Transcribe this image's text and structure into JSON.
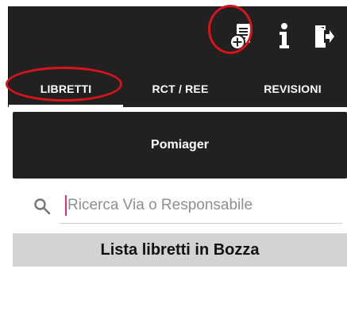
{
  "toolbar": {
    "actions": [
      {
        "icon": "new-document-icon"
      },
      {
        "icon": "info-icon"
      },
      {
        "icon": "logout-icon"
      }
    ]
  },
  "tabs": [
    {
      "label": "LIBRETTI",
      "active": true
    },
    {
      "label": "RCT / REE",
      "active": false
    },
    {
      "label": "REVISIONI",
      "active": false
    }
  ],
  "primary_button": {
    "label": "Pomiager"
  },
  "search": {
    "placeholder": "Ricerca Via o Responsabile"
  },
  "list": {
    "title": "Lista libretti in Bozza"
  },
  "colors": {
    "appbar": "#212121",
    "annotation": "#d9131a",
    "list_header": "#d3d3d3",
    "cursor": "#e0307a"
  }
}
